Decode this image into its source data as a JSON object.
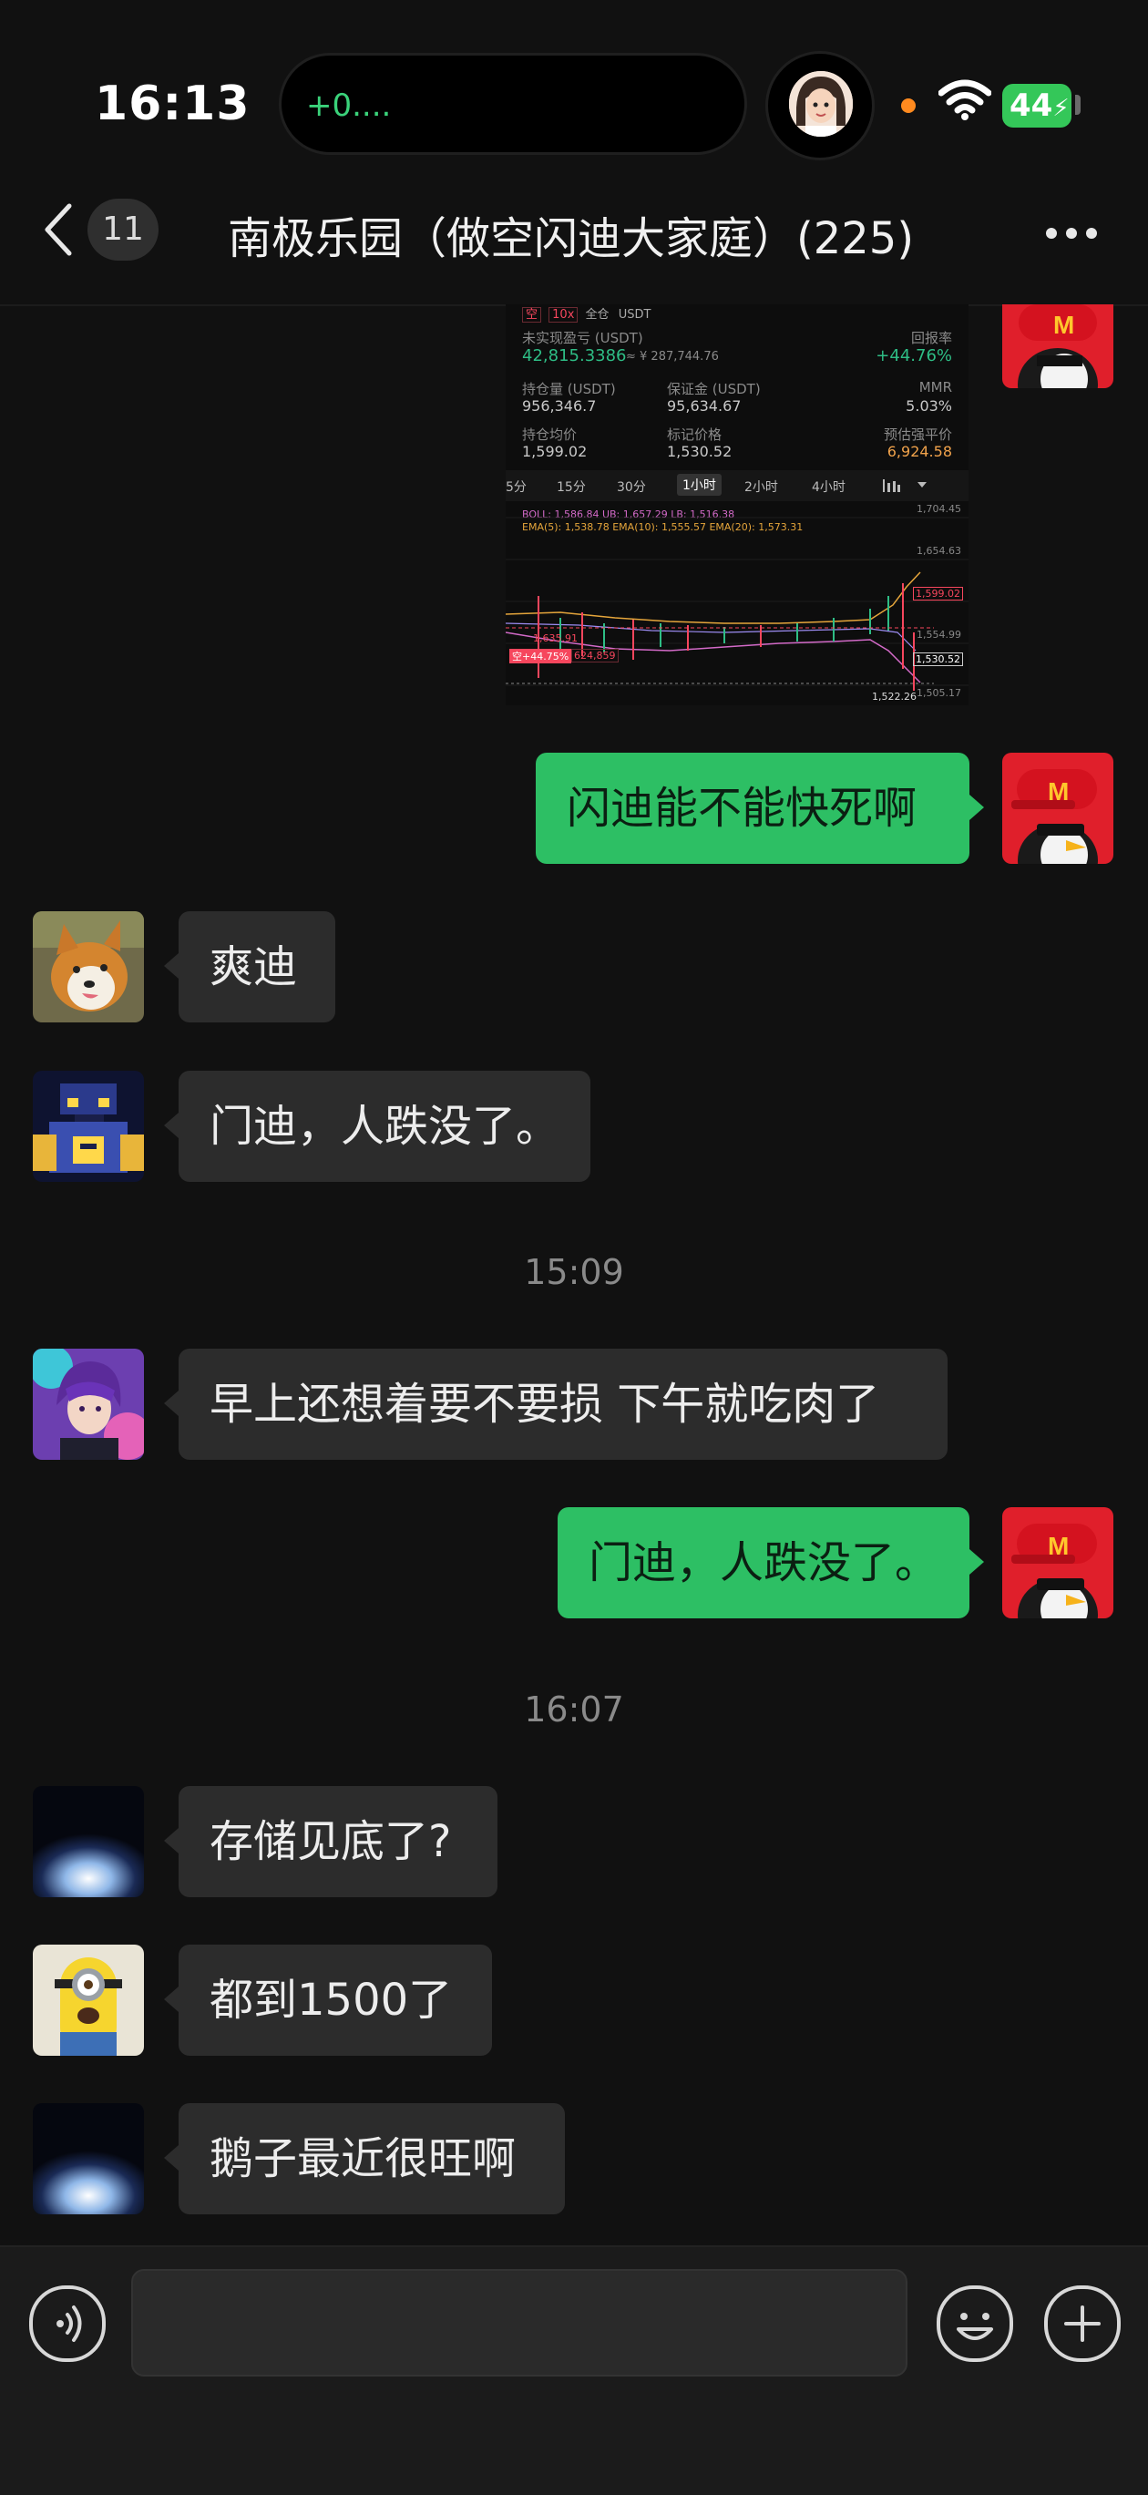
{
  "status_bar": {
    "time": "16:13",
    "island_text": "+0....",
    "battery": "44"
  },
  "nav": {
    "unread_count": "11",
    "title": "南极乐园（做空闪迪大家庭）(225)"
  },
  "screenshot": {
    "tag_side": "空",
    "tag_leverage": "10x",
    "tag_margin": "全仓",
    "tag_asset": "USDT",
    "unrealized_label": "未实现盈亏 (USDT)",
    "unrealized_value": "42,815.3386",
    "unrealized_cny": "≈ ¥ 287,744.76",
    "roe_label": "回报率",
    "roe_value": "+44.76%",
    "position_label": "持仓量 (USDT)",
    "position_value": "956,346.7",
    "margin_label": "保证金 (USDT)",
    "margin_value": "95,634.67",
    "mmr_label": "MMR",
    "mmr_value": "5.03%",
    "avg_label": "持仓均价",
    "avg_value": "1,599.02",
    "mark_label": "标记价格",
    "mark_value": "1,530.52",
    "liq_label": "预估强平价",
    "liq_value": "6,924.58",
    "intervals": [
      "5分",
      "15分",
      "30分",
      "1小时",
      "2小时",
      "4小时"
    ],
    "boll_line": "BOLL: 1,586.84  UB: 1,657.29  LB: 1,516.38",
    "ema_line": "EMA(5): 1,538.78  EMA(10): 1,555.57  EMA(20): 1,573.31",
    "price_ticks": [
      "1,704.45",
      "1,654.63",
      "1,599.02",
      "1,554.99",
      "1,530.52",
      "1,505.17"
    ],
    "high_marker": "1,635.91",
    "low_marker": "1,522.26",
    "position_tag": "空+44.75%",
    "position_qty": "624,859"
  },
  "messages": [
    {
      "side": "out",
      "text": "闪迪能不能快死啊"
    },
    {
      "side": "in",
      "text": "爽迪"
    },
    {
      "side": "in",
      "text": "门迪，人跌没了。"
    },
    {
      "type": "time",
      "text": "15:09"
    },
    {
      "side": "in",
      "text": "早上还想着要不要损 下午就吃肉了"
    },
    {
      "side": "out",
      "text": "门迪，人跌没了。"
    },
    {
      "type": "time",
      "text": "16:07"
    },
    {
      "side": "in",
      "text": "存储见底了?"
    },
    {
      "side": "in",
      "text": "都到1500了"
    },
    {
      "side": "in",
      "text": "鹅子最近很旺啊"
    }
  ],
  "icons": {
    "back": "chevron-left-icon",
    "more": "more-horizontal-icon",
    "voice": "voice-icon",
    "emoji": "emoji-icon",
    "plus": "plus-icon"
  },
  "colors": {
    "background": "#111111",
    "outgoing_bubble": "#2dbf64",
    "incoming_bubble": "#2c2c2c",
    "profit_green": "#2ebd85",
    "loss_red": "#f6465d"
  }
}
